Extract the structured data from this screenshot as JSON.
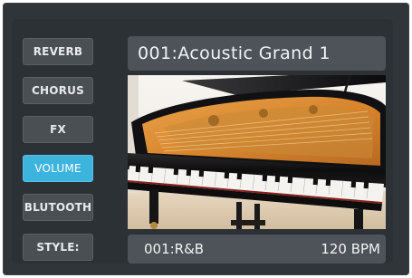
{
  "side_menu": {
    "items": [
      {
        "label": "REVERB",
        "active": false
      },
      {
        "label": "CHORUS",
        "active": false
      },
      {
        "label": "FX",
        "active": false
      },
      {
        "label": "VOLUME",
        "active": true
      },
      {
        "label": "BLUTOOTH",
        "active": false
      },
      {
        "label": "STYLE:",
        "active": false
      }
    ]
  },
  "voice": {
    "title": "001:Acoustic Grand 1"
  },
  "status": {
    "style": "001:R&B",
    "tempo": "120 BPM"
  },
  "colors": {
    "panel": "#303539",
    "button": "#4a4f54",
    "active_button": "#3cb4de",
    "display_bar": "#4d5358",
    "text": "#f2f3f4"
  },
  "image": {
    "subject": "grand-piano-photo"
  }
}
